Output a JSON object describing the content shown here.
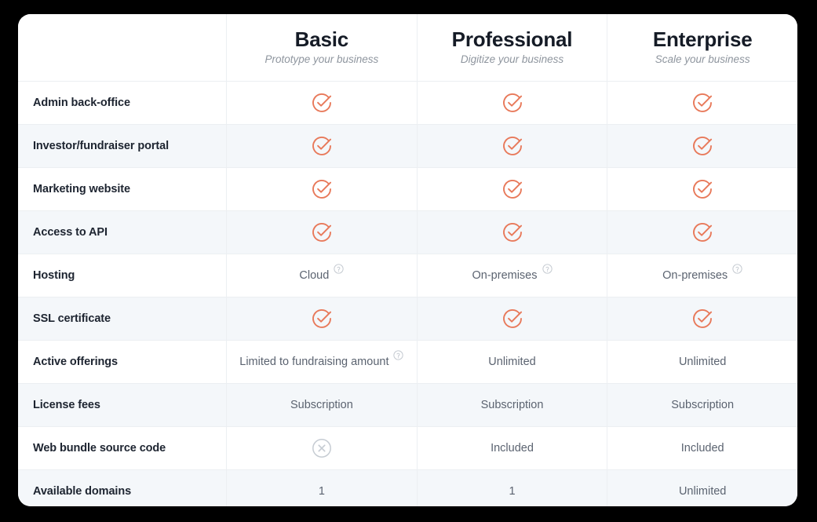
{
  "table": {
    "feature_column_header": "",
    "plans": [
      {
        "name": "Basic",
        "tagline": "Prototype your business"
      },
      {
        "name": "Professional",
        "tagline": "Digitize your business"
      },
      {
        "name": "Enterprise",
        "tagline": "Scale your business"
      }
    ],
    "rows": [
      {
        "feature": "Admin back-office",
        "values": [
          {
            "type": "check",
            "text": "",
            "info": false
          },
          {
            "type": "check",
            "text": "",
            "info": false
          },
          {
            "type": "check",
            "text": "",
            "info": false
          }
        ]
      },
      {
        "feature": "Investor/fundraiser portal",
        "values": [
          {
            "type": "check",
            "text": "",
            "info": false
          },
          {
            "type": "check",
            "text": "",
            "info": false
          },
          {
            "type": "check",
            "text": "",
            "info": false
          }
        ]
      },
      {
        "feature": "Marketing website",
        "values": [
          {
            "type": "check",
            "text": "",
            "info": false
          },
          {
            "type": "check",
            "text": "",
            "info": false
          },
          {
            "type": "check",
            "text": "",
            "info": false
          }
        ]
      },
      {
        "feature": "Access to API",
        "values": [
          {
            "type": "check",
            "text": "",
            "info": false
          },
          {
            "type": "check",
            "text": "",
            "info": false
          },
          {
            "type": "check",
            "text": "",
            "info": false
          }
        ]
      },
      {
        "feature": "Hosting",
        "values": [
          {
            "type": "text",
            "text": "Cloud",
            "info": true
          },
          {
            "type": "text",
            "text": "On-premises",
            "info": true
          },
          {
            "type": "text",
            "text": "On-premises",
            "info": true
          }
        ]
      },
      {
        "feature": "SSL certificate",
        "values": [
          {
            "type": "check",
            "text": "",
            "info": false
          },
          {
            "type": "check",
            "text": "",
            "info": false
          },
          {
            "type": "check",
            "text": "",
            "info": false
          }
        ]
      },
      {
        "feature": "Active offerings",
        "values": [
          {
            "type": "text",
            "text": "Limited to fundraising amount",
            "info": true
          },
          {
            "type": "text",
            "text": "Unlimited",
            "info": false
          },
          {
            "type": "text",
            "text": "Unlimited",
            "info": false
          }
        ]
      },
      {
        "feature": "License fees",
        "values": [
          {
            "type": "text",
            "text": "Subscription",
            "info": false
          },
          {
            "type": "text",
            "text": "Subscription",
            "info": false
          },
          {
            "type": "text",
            "text": "Subscription",
            "info": false
          }
        ]
      },
      {
        "feature": "Web bundle source code",
        "values": [
          {
            "type": "cross",
            "text": "",
            "info": false
          },
          {
            "type": "text",
            "text": "Included",
            "info": false
          },
          {
            "type": "text",
            "text": "Included",
            "info": false
          }
        ]
      },
      {
        "feature": "Available domains",
        "values": [
          {
            "type": "text",
            "text": "1",
            "info": false
          },
          {
            "type": "text",
            "text": "1",
            "info": false
          },
          {
            "type": "text",
            "text": "Unlimited",
            "info": false
          }
        ]
      }
    ]
  },
  "icons": {
    "check": "check-circle-icon",
    "cross": "cross-circle-icon",
    "info": "info-question-icon"
  },
  "colors": {
    "check_accent": "#e8795a",
    "cross_gray": "#c6ccd3",
    "info_gray": "#c2c8cf",
    "row_shade": "#f4f7fa",
    "divider": "#eceff2",
    "heading_text": "#151b26",
    "feature_text": "#1d2430",
    "value_text": "#5b6370",
    "tagline_text": "#8e959e",
    "page_background": "#000000",
    "card_background": "#ffffff"
  }
}
